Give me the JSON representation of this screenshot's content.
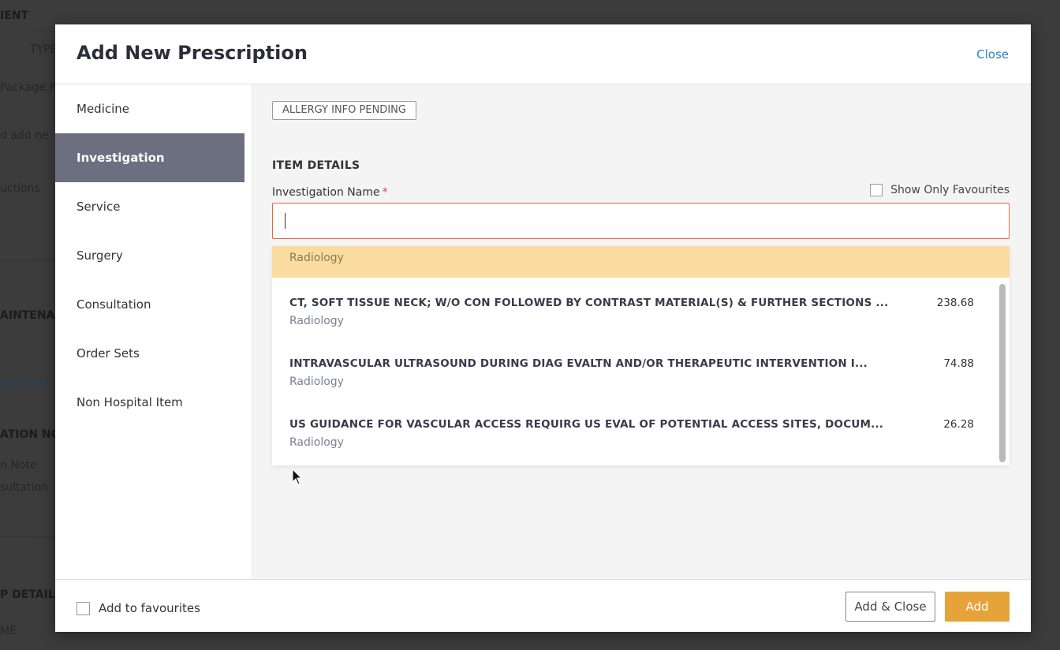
{
  "background": {
    "texts": [
      "IENT",
      "TYPE",
      "Package P",
      "d add ne",
      "uctions",
      "AINTENA",
      "aintenan",
      "ATION NO",
      "n Note",
      "sultation",
      "P DETAIL",
      "ME"
    ]
  },
  "modal": {
    "title": "Add New Prescription",
    "close_label": "Close"
  },
  "sidebar": {
    "items": [
      {
        "label": "Medicine",
        "active": false
      },
      {
        "label": "Investigation",
        "active": true
      },
      {
        "label": "Service",
        "active": false
      },
      {
        "label": "Surgery",
        "active": false
      },
      {
        "label": "Consultation",
        "active": false
      },
      {
        "label": "Order Sets",
        "active": false
      },
      {
        "label": "Non Hospital Item",
        "active": false
      }
    ]
  },
  "content": {
    "allergy_badge": "ALLERGY INFO PENDING",
    "section_title": "ITEM DETAILS",
    "field_label": "Investigation Name",
    "required_marker": "*",
    "favourites_label": "Show Only Favourites",
    "search_value": ""
  },
  "dropdown": {
    "group_header": "Radiology",
    "results": [
      {
        "name": "CT, SOFT TISSUE NECK; W/O CON FOLLOWED BY CONTRAST MATERIAL(S) & FURTHER SECTIONS ...",
        "category": "Radiology",
        "price": "238.68"
      },
      {
        "name": "INTRAVASCULAR ULTRASOUND DURING DIAG EVALTN AND/OR THERAPEUTIC INTERVENTION I...",
        "category": "Radiology",
        "price": "74.88"
      },
      {
        "name": "US GUIDANCE FOR VASCULAR ACCESS REQUIRG US EVAL OF POTENTIAL ACCESS SITES, DOCUM...",
        "category": "Radiology",
        "price": "26.28"
      }
    ]
  },
  "footer": {
    "add_to_favourites": "Add to favourites",
    "add_close_label": "Add & Close",
    "add_label": "Add"
  },
  "colors": {
    "accent": "#e6a33a",
    "active_sidebar": "#6b6f80",
    "link": "#2b7fc4",
    "group_header_bg": "#fbdca0",
    "input_border": "#e06a3a"
  },
  "icons": {
    "cursor": "mouse-pointer-icon"
  }
}
